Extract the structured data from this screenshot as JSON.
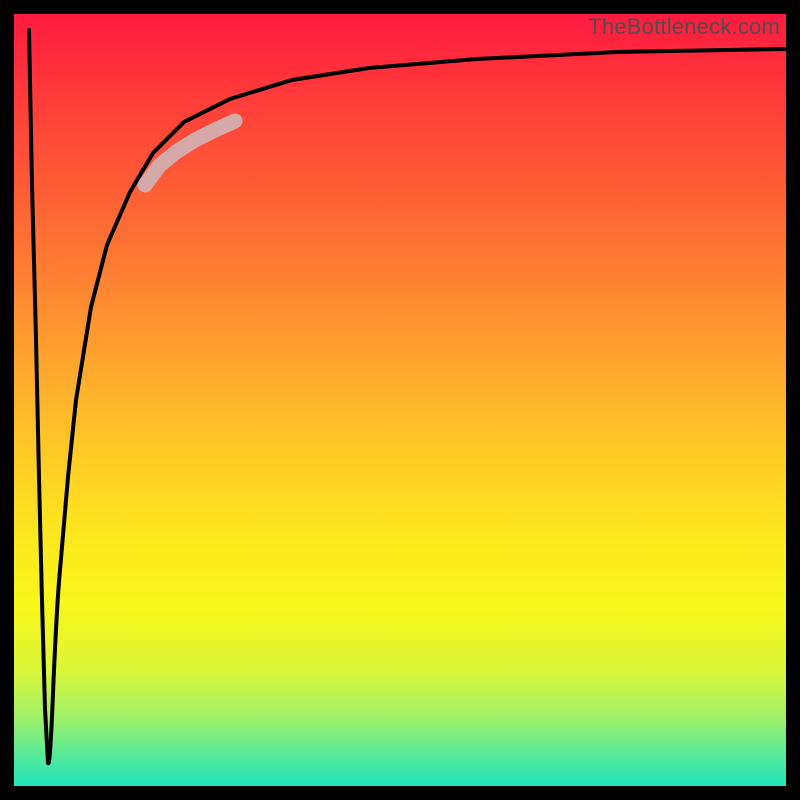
{
  "watermark": {
    "text": "TheBottleneck.com"
  },
  "colors": {
    "frame": "#000000",
    "curve": "#000000",
    "highlight": "#d6a9a9",
    "gradient_stops": [
      "#ff1440",
      "#ff3b3a",
      "#ff6a34",
      "#ff9a2f",
      "#ffc528",
      "#fde81f",
      "#f7f71a",
      "#d9f63a",
      "#9cf06c",
      "#4de89f",
      "#09e1c6"
    ]
  },
  "chart_data": {
    "type": "line",
    "title": "",
    "xlabel": "",
    "ylabel": "",
    "xlim": [
      0,
      100
    ],
    "ylim": [
      0,
      100
    ],
    "series": [
      {
        "name": "bottleneck-curve-left",
        "x": [
          2.0,
          2.4,
          2.8,
          3.2,
          3.6,
          4.0,
          4.4
        ],
        "y": [
          98,
          78,
          58,
          40,
          24,
          10,
          3
        ]
      },
      {
        "name": "bottleneck-curve-right",
        "x": [
          4.4,
          5,
          6,
          7,
          8,
          10,
          12,
          15,
          18,
          22,
          28,
          36,
          46,
          60,
          78,
          100
        ],
        "y": [
          3,
          12,
          28,
          40,
          50,
          62,
          70,
          77,
          82,
          86,
          89,
          91.5,
          93,
          94.2,
          95,
          95.5
        ]
      }
    ],
    "annotations": [
      {
        "name": "highlight-segment",
        "x_range": [
          18,
          28
        ],
        "note": "thick pale stroke over curve"
      }
    ]
  }
}
